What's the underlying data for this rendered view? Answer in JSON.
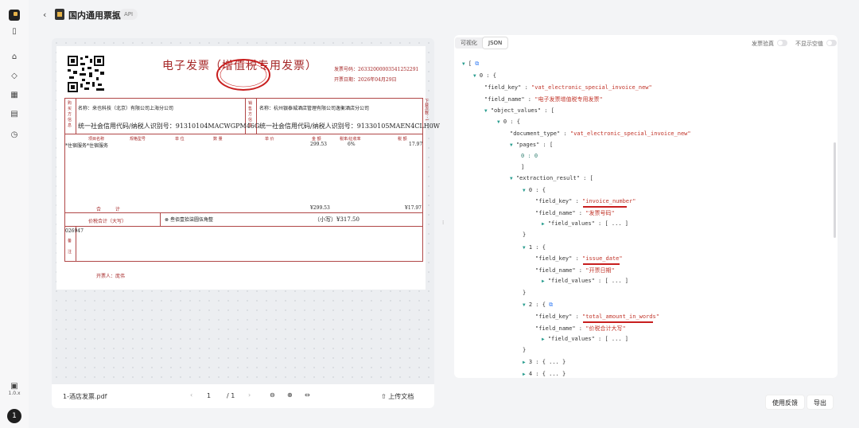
{
  "app": {
    "title": "国内通用票据",
    "badge": "API",
    "version": "1.0.x",
    "avatar": "1"
  },
  "viewer": {
    "filename": "1-酒店发票.pdf",
    "page_current": "1",
    "page_total": "/ 1",
    "upload_label": "上传文档"
  },
  "invoice": {
    "title": "电子发票（增值税专用发票）",
    "number_label": "发票号码：26332000003541252291",
    "date_label": "开票日期：2026年04月29日",
    "buyer_side": "购买方信息",
    "buyer_name": "名称：来也科技（北京）有限公司上海分公司",
    "buyer_taxid": "统一社会信用代码/纳税人识别号：91310104MACWGPM46G",
    "seller_side": "销售方信息",
    "seller_name": "名称：杭州银泰城酒店管理有限公司逸衡酒店分公司",
    "seller_taxid": "统一社会信用代码/纳税人识别号：91330105MAEN4CLH0W",
    "cols": [
      "项目名称",
      "规格型号",
      "单 位",
      "数 量",
      "单 价",
      "金 额",
      "税率/征收率",
      "税 额"
    ],
    "item_name": "*住宿服务*住宿服务",
    "item_amount": "299.53",
    "item_rate": "6%",
    "item_tax": "17.97",
    "total_label": "合 计",
    "total_amount": "¥299.53",
    "total_tax": "¥17.97",
    "words_label": "价税合计（大写）",
    "words_value": "叁佰壹拾柒圆伍角整",
    "small_label": "（小写）¥317.50",
    "remark_side": "备注",
    "remark_text": "026947",
    "issuer": "开票人：庞伟",
    "side_note": "下载次数：1"
  },
  "panel": {
    "tabs": [
      "可视化",
      "JSON"
    ],
    "toggle1": "发票验真",
    "toggle2": "不显示空值",
    "feedback": "使用反馈",
    "export": "导出"
  },
  "json_lines": {
    "l1": "0 : {",
    "l2k": "\"field_key\"",
    "l2v": "\"vat_electronic_special_invoice_new\"",
    "l3k": "\"field_name\"",
    "l3v": "\"电子发票增值税专用发票\"",
    "l4": "\"object_values\" : [",
    "l5": "0 : {",
    "l6k": "\"document_type\"",
    "l6v": "\"vat_electronic_special_invoice_new\"",
    "l7": "\"pages\" : [",
    "l8": "0 : 0",
    "l9": "]",
    "l10": "\"extraction_result\" : [",
    "l11": "0 : {",
    "l12k": "\"field_key\"",
    "l12v": "\"invoice_number\"",
    "l13k": "\"field_name\"",
    "l13v": "\"发票号码\"",
    "l14": "\"field_values\" : [ ... ]",
    "l15": "}",
    "l16": "1 : {",
    "l17k": "\"field_key\"",
    "l17v": "\"issue_date\"",
    "l18k": "\"field_name\"",
    "l18v": "\"开票日期\"",
    "l19": "\"field_values\" : [ ... ]",
    "l20": "}",
    "l21": "2 : {",
    "l22k": "\"field_key\"",
    "l22v": "\"total_amount_in_words\"",
    "l23k": "\"field_name\"",
    "l23v": "\"价税合计大写\"",
    "l24": "\"field_values\" : [ ... ]",
    "l25": "}",
    "l26": "3 : { ... }",
    "l27": "4 : { ... }"
  },
  "colors": {
    "accent": "#c1352a",
    "stamp": "#c81e1e"
  }
}
